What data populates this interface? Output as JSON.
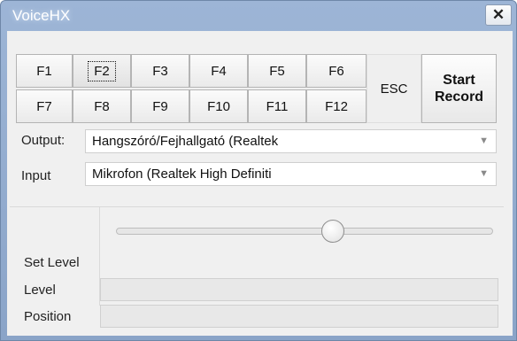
{
  "window": {
    "title": "VoiceHX",
    "close_glyph": "✕"
  },
  "function_keys": {
    "row1": [
      "F1",
      "F2",
      "F3",
      "F4",
      "F5",
      "F6"
    ],
    "row2": [
      "F7",
      "F8",
      "F9",
      "F10",
      "F11",
      "F12"
    ],
    "selected": "F2"
  },
  "esc_label": "ESC",
  "start_record": {
    "line1": "Start",
    "line2": "Record"
  },
  "output": {
    "label": "Output:",
    "value": "Hangszóró/Fejhallgató (Realtek"
  },
  "input": {
    "label": "Input",
    "value": "Mikrofon (Realtek High Definiti"
  },
  "level_panel": {
    "set_level_label": "Set Level",
    "set_level_value": 0.58,
    "level_label": "Level",
    "position_label": "Position"
  }
}
